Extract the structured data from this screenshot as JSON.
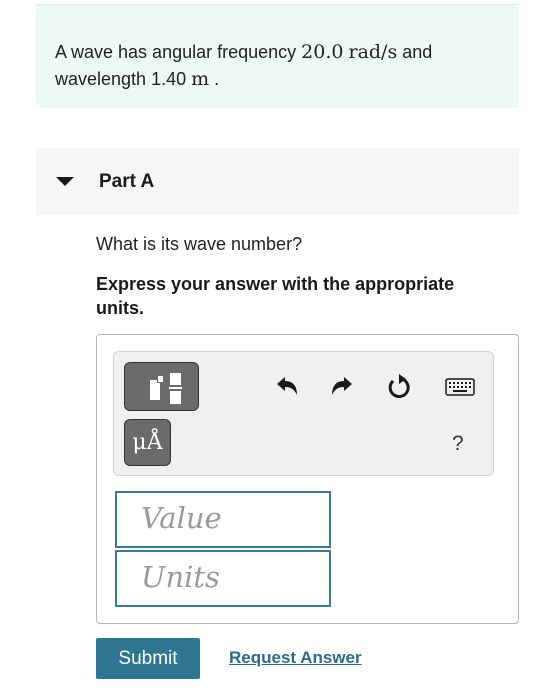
{
  "problem": {
    "text_before": "A wave has angular frequency ",
    "frequency_value": "20.0",
    "frequency_unit": "rad/s",
    "text_middle": " and wavelength ",
    "wavelength_value": "1.40",
    "wavelength_unit": "m",
    "text_end": " ."
  },
  "part": {
    "title": "Part A",
    "question": "What is its wave number?",
    "instruction": "Express your answer with the appropriate units."
  },
  "toolbar": {
    "template_icon": "template-icon",
    "units_label": "μÅ",
    "undo_icon": "undo-icon",
    "redo_icon": "redo-icon",
    "reset_icon": "reset-icon",
    "keyboard_icon": "keyboard-icon",
    "help_label": "?"
  },
  "inputs": {
    "value_placeholder": "Value",
    "units_placeholder": "Units"
  },
  "actions": {
    "submit_label": "Submit",
    "request_label": "Request Answer"
  },
  "colors": {
    "accent": "#2d7591",
    "link": "#2d6a8d",
    "problem_bg": "#eef8f7"
  }
}
